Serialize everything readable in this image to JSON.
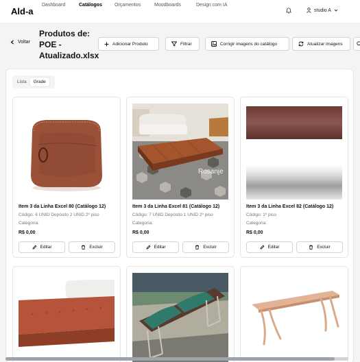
{
  "app": {
    "logo": "Ald-a"
  },
  "nav": {
    "items": [
      "Dashboard",
      "Catálogos",
      "Orçamentos",
      "Moodboards",
      "Design com IA"
    ],
    "active_index": 1
  },
  "user": {
    "name": "studio A"
  },
  "header": {
    "back_label": "Voltar",
    "title": "Produtos de: POE - Atualizado.xlsx",
    "buttons": {
      "add": "Adicionar Produto",
      "filter": "Filtrar",
      "fix_images": "Corrigir imagens do catálogo",
      "refresh_images": "Atualizar imagens"
    }
  },
  "view_toggle": {
    "list": "Lista",
    "grid": "Grade",
    "active": "grid"
  },
  "products": [
    {
      "title": "Item 3 da Linha Excel 80 (Catálogo 12)",
      "code": "Código: 6 UNID Depósito 2 UNID 2º piso",
      "category": "Categoria:",
      "price": "R$ 0,00",
      "image": "leather-pouf"
    },
    {
      "title": "Item 3 da Linha Excel 81 (Catálogo 12)",
      "code": "Código: 7 UNID Depósito 1 UNID 2º piso",
      "category": "Categoria:",
      "price": "R$ 0,00",
      "image": "leather-bench-room",
      "watermark": "Rosanje"
    },
    {
      "title": "Item 3 da Linha Excel 82 (Catálogo 12)",
      "code": "Código: 1º piso",
      "category": "Categoria:",
      "price": "R$ 0,00",
      "image": "color-swatches"
    },
    {
      "image": "orange-bench"
    },
    {
      "image": "green-cushion-bench"
    },
    {
      "image": "wooden-bench"
    }
  ],
  "actions": {
    "edit": "Editar",
    "delete": "Excluir"
  },
  "colors": {
    "border": "#e4e4e7",
    "leather": "#9a5138",
    "green": "#2f7a6b",
    "wood": "#d9a98a"
  }
}
